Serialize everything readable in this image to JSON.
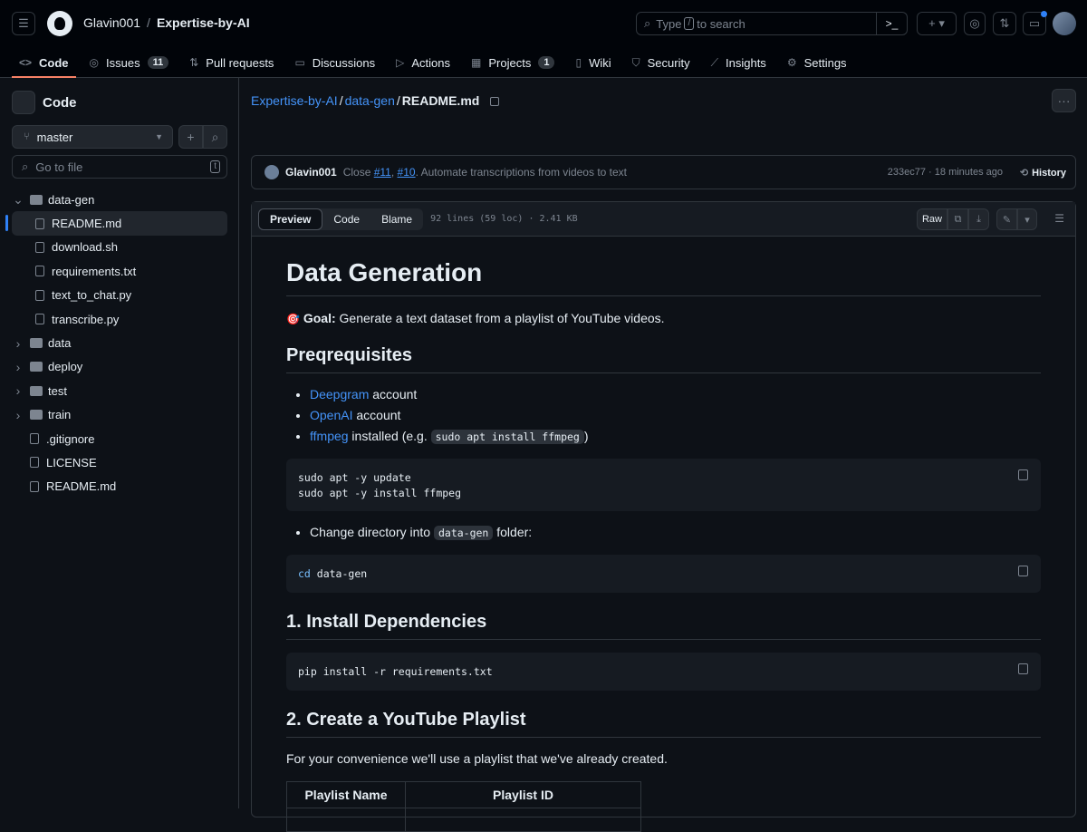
{
  "header": {
    "owner": "Glavin001",
    "repo": "Expertise-by-AI",
    "search_placeholder": "Type",
    "search_key": "/",
    "search_suffix": "to search"
  },
  "nav_tabs": [
    {
      "label": "Code",
      "icon": "code-icon",
      "active": true
    },
    {
      "label": "Issues",
      "icon": "issue-icon",
      "count": "11"
    },
    {
      "label": "Pull requests",
      "icon": "pull-request-icon"
    },
    {
      "label": "Discussions",
      "icon": "discussion-icon"
    },
    {
      "label": "Actions",
      "icon": "play-icon"
    },
    {
      "label": "Projects",
      "icon": "table-icon",
      "count": "1"
    },
    {
      "label": "Wiki",
      "icon": "book-icon"
    },
    {
      "label": "Security",
      "icon": "shield-icon"
    },
    {
      "label": "Insights",
      "icon": "graph-icon"
    },
    {
      "label": "Settings",
      "icon": "gear-icon"
    }
  ],
  "sidebar": {
    "title": "Code",
    "branch": "master",
    "goto_placeholder": "Go to file",
    "goto_key": "t",
    "tree": [
      {
        "name": "data-gen",
        "type": "folder",
        "open": true
      },
      {
        "name": "README.md",
        "type": "file",
        "child": true,
        "selected": true
      },
      {
        "name": "download.sh",
        "type": "file",
        "child": true
      },
      {
        "name": "requirements.txt",
        "type": "file",
        "child": true
      },
      {
        "name": "text_to_chat.py",
        "type": "file",
        "child": true
      },
      {
        "name": "transcribe.py",
        "type": "file",
        "child": true
      },
      {
        "name": "data",
        "type": "folder"
      },
      {
        "name": "deploy",
        "type": "folder"
      },
      {
        "name": "test",
        "type": "folder"
      },
      {
        "name": "train",
        "type": "folder"
      },
      {
        "name": ".gitignore",
        "type": "file"
      },
      {
        "name": "LICENSE",
        "type": "file"
      },
      {
        "name": "README.md",
        "type": "file"
      }
    ]
  },
  "breadcrumb": {
    "repo": "Expertise-by-AI",
    "dir": "data-gen",
    "file": "README.md"
  },
  "commit": {
    "author": "Glavin001",
    "msg_prefix": "Close ",
    "ref1": "#11",
    "ref_sep": ", ",
    "ref2": "#10",
    "msg_suffix": ". Automate transcriptions from videos to text",
    "meta": "233ec77 · 18 minutes ago",
    "history": "History"
  },
  "filebar": {
    "tabs": [
      "Preview",
      "Code",
      "Blame"
    ],
    "meta": "92 lines (59 loc) · 2.41 KB",
    "raw": "Raw"
  },
  "readme": {
    "h1": "Data Generation",
    "goal_emoji": "🎯",
    "goal_label": "Goal:",
    "goal_text": " Generate a text dataset from a playlist of YouTube videos.",
    "h2_prereq": "Preqrequisites",
    "prereq": [
      {
        "link": "Deepgram",
        "text": " account"
      },
      {
        "link": "OpenAI",
        "text": " account"
      },
      {
        "link": "ffmpeg",
        "text": " installed (e.g. ",
        "code": "sudo apt install ffmpeg",
        "after": ")"
      }
    ],
    "code1_l1": "sudo apt -y update",
    "code1_l2": "sudo apt -y install ffmpeg",
    "cd_text": "Change directory into ",
    "cd_code": "data-gen",
    "cd_after": " folder:",
    "code2_kw": "cd",
    "code2_rest": " data-gen",
    "h2_install": "1. Install Dependencies",
    "code3": "pip install -r requirements.txt",
    "h2_playlist": "2. Create a YouTube Playlist",
    "playlist_text": "For your convenience we'll use a playlist that we've already created.",
    "table_headers": [
      "Playlist Name",
      "Playlist ID"
    ]
  }
}
